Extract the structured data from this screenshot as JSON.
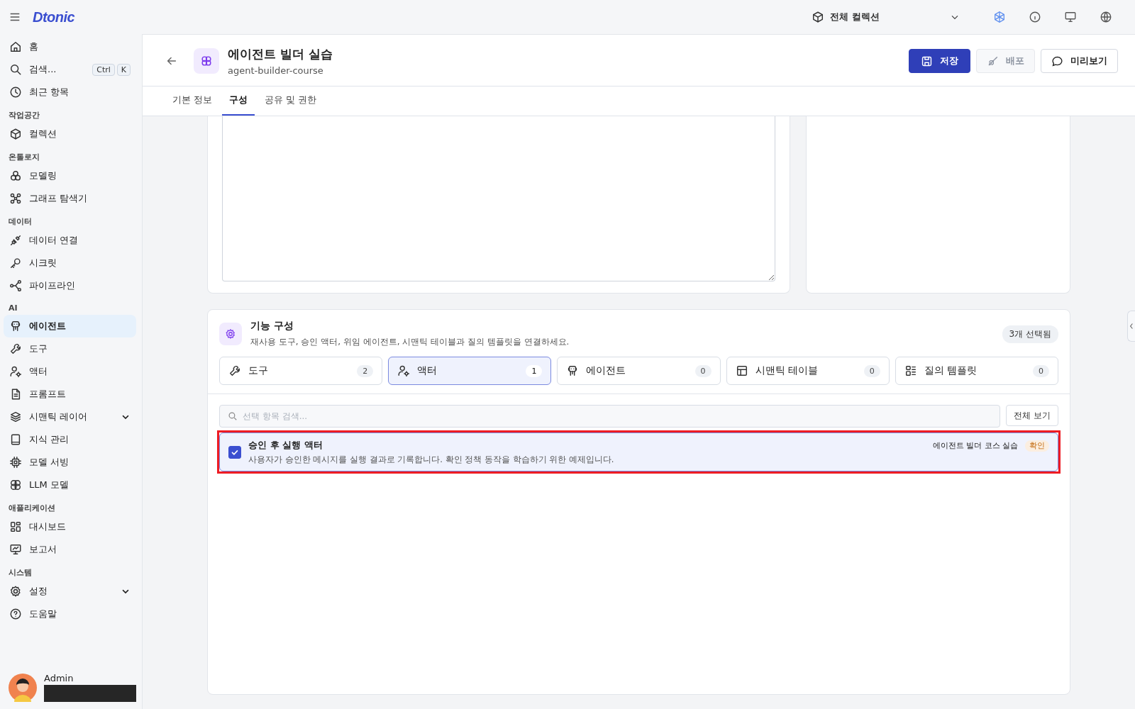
{
  "logo": "Dtonic",
  "sidebar": {
    "groups": [
      {
        "items": [
          {
            "label": "홈",
            "selected": false
          },
          {
            "label": "검색...",
            "selected": false,
            "shortcut": [
              "Ctrl",
              "K"
            ]
          },
          {
            "label": "최근 항목",
            "selected": false
          }
        ]
      },
      {
        "heading": "작업공간",
        "items": [
          {
            "label": "컬렉션",
            "selected": false
          }
        ]
      },
      {
        "heading": "온톨로지",
        "items": [
          {
            "label": "모델링",
            "selected": false
          },
          {
            "label": "그래프 탐색기",
            "selected": false
          }
        ]
      },
      {
        "heading": "데이터",
        "items": [
          {
            "label": "데이터 연결",
            "selected": false
          },
          {
            "label": "시크릿",
            "selected": false
          },
          {
            "label": "파이프라인",
            "selected": false
          }
        ]
      },
      {
        "heading": "AI",
        "items": [
          {
            "label": "에이전트",
            "selected": true
          },
          {
            "label": "도구",
            "selected": false
          },
          {
            "label": "액터",
            "selected": false
          },
          {
            "label": "프롬프트",
            "selected": false
          },
          {
            "label": "시맨틱 레이어",
            "selected": false,
            "expanded": false
          },
          {
            "label": "지식 관리",
            "selected": false
          },
          {
            "label": "모델 서빙",
            "selected": false
          },
          {
            "label": "LLM 모델",
            "selected": false
          }
        ]
      },
      {
        "heading": "애플리케이션",
        "items": [
          {
            "label": "대시보드",
            "selected": false
          },
          {
            "label": "보고서",
            "selected": false
          }
        ]
      },
      {
        "heading": "시스템",
        "items": [
          {
            "label": "설정",
            "selected": false,
            "expanded": false
          },
          {
            "label": "도움말",
            "selected": false
          }
        ]
      }
    ],
    "user": {
      "name": "Admin"
    }
  },
  "top_bar": {
    "collection_select": "전체 컬렉션"
  },
  "header": {
    "title": "에이전트 빌더 실습",
    "subtitle": "agent-builder-course",
    "buttons": [
      {
        "label": "저장",
        "kind": "primary",
        "disabled": false
      },
      {
        "label": "배포",
        "kind": "default",
        "disabled": true
      },
      {
        "label": "미리보기",
        "kind": "default",
        "disabled": false
      }
    ],
    "tabs": [
      {
        "label": "기본 정보",
        "selected": false
      },
      {
        "label": "구성",
        "selected": true
      },
      {
        "label": "공유 및 권한",
        "selected": false
      }
    ]
  },
  "feature_panel": {
    "title": "기능 구성",
    "description": "재사용 도구, 승인 액터, 위임 에이전트, 시맨틱 테이블과 질의 템플릿을 연결하세요.",
    "selected_count": "3개 선택됨",
    "tabs": [
      {
        "label": "도구",
        "count": "2",
        "selected": false
      },
      {
        "label": "액터",
        "count": "1",
        "selected": true
      },
      {
        "label": "에이전트",
        "count": "0",
        "selected": false
      },
      {
        "label": "시맨틱 테이블",
        "count": "0",
        "selected": false
      },
      {
        "label": "질의 템플릿",
        "count": "0",
        "selected": false
      }
    ],
    "search": {
      "placeholder": "선택 항목 검색..."
    },
    "view_all": "전체 보기",
    "items": [
      {
        "title": "승인 후 실행 액터",
        "description": "사용자가 승인한 메시지를 실행 결과로 기록합니다. 확인 정책 동작을 학습하기 위한 예제입니다.",
        "source": "에이전트 빌더 코스 실습",
        "tag": "확인",
        "checked": true,
        "highlighted": true
      }
    ]
  }
}
